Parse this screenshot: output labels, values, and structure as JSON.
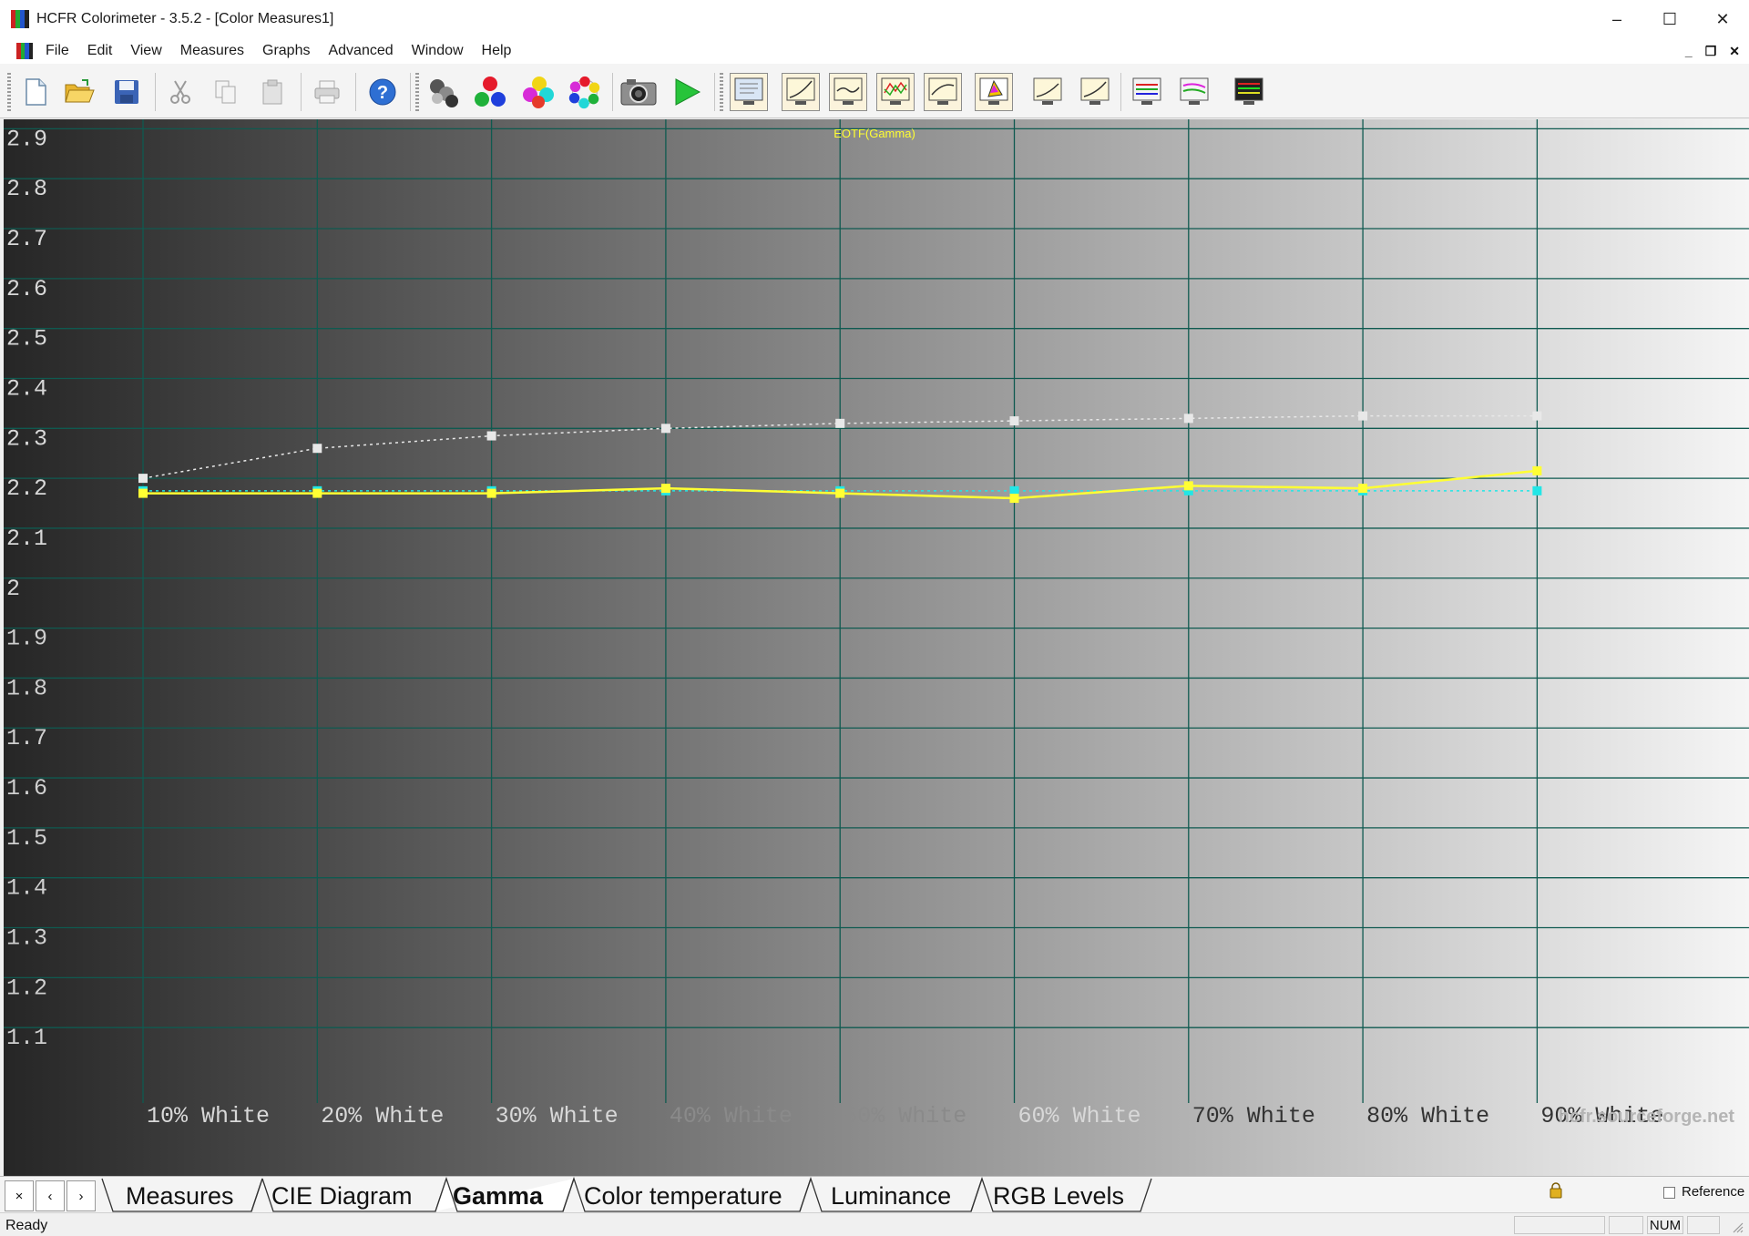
{
  "window": {
    "title": "HCFR Colorimeter - 3.5.2 - [Color Measures1]",
    "controls": [
      "–",
      "☐",
      "✕"
    ]
  },
  "menu": {
    "items": [
      "File",
      "Edit",
      "View",
      "Measures",
      "Graphs",
      "Advanced",
      "Window",
      "Help"
    ]
  },
  "toolbar": {
    "buttons": [
      "new-document-icon",
      "open-folder-icon",
      "save-icon",
      "cut-icon",
      "copy-icon",
      "paste-icon",
      "print-icon",
      "help-icon",
      "measure-grayscale-icon",
      "measure-primaries-icon",
      "measure-secondaries-icon",
      "measure-saturations-icon",
      "camera-icon",
      "play-icon",
      "graph-view-icon-1",
      "graph-view-icon-2",
      "graph-view-icon-3",
      "graph-view-icon-4",
      "graph-view-icon-5",
      "graph-view-icon-6",
      "graph-view-icon-7",
      "graph-view-icon-8",
      "graph-view-icon-9",
      "graph-view-icon-10",
      "graph-view-icon-11"
    ]
  },
  "chart_data": {
    "type": "line",
    "title": "EOTF(Gamma)",
    "categories": [
      "10% White",
      "20% White",
      "30% White",
      "40% White",
      "50% White",
      "60% White",
      "70% White",
      "80% White",
      "90% White"
    ],
    "y_ticks": [
      "2.9",
      "2.8",
      "2.7",
      "2.6",
      "2.5",
      "2.4",
      "2.3",
      "2.2",
      "2.1",
      "2",
      "1.9",
      "1.8",
      "1.7",
      "1.6",
      "1.5",
      "1.4",
      "1.3",
      "1.2",
      "1.1"
    ],
    "ylim": [
      1.0,
      2.97
    ],
    "grid": true,
    "watermark": "hcfr.sourceforge.net",
    "series": [
      {
        "color": "#ffff33",
        "style": "solid",
        "values": [
          2.17,
          2.17,
          2.17,
          2.18,
          2.17,
          2.16,
          2.185,
          2.18,
          2.215
        ]
      },
      {
        "color": "#e8e8e8",
        "style": "dotted",
        "values": [
          2.2,
          2.26,
          2.285,
          2.3,
          2.31,
          2.315,
          2.32,
          2.325,
          2.325
        ]
      },
      {
        "color": "#22e6e6",
        "style": "dotted",
        "values": [
          2.175,
          2.175,
          2.175,
          2.175,
          2.175,
          2.175,
          2.175,
          2.175,
          2.175
        ]
      }
    ]
  },
  "tabs": {
    "nav": [
      "×",
      "‹",
      "›"
    ],
    "items": [
      "Measures",
      "CIE Diagram",
      "Gamma",
      "Color temperature",
      "Luminance",
      "RGB Levels"
    ],
    "active_index": 2,
    "reference_label": "Reference"
  },
  "status": {
    "text": "Ready",
    "num": "NUM"
  }
}
